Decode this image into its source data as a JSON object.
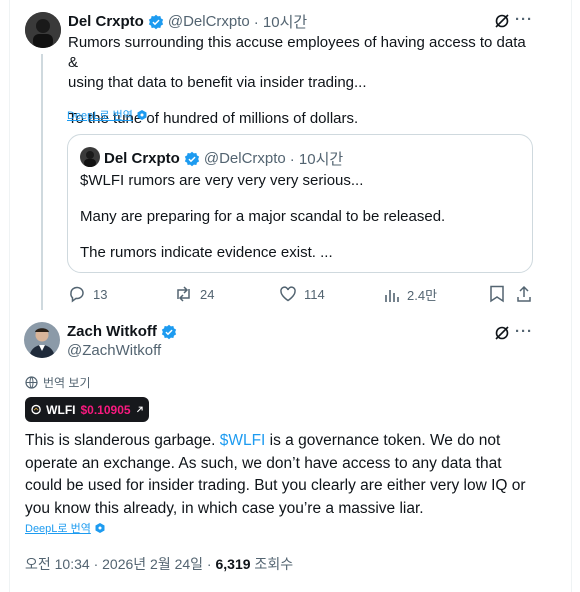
{
  "tweet1": {
    "name": "Del Crxpto",
    "handle": "@DelCrxpto",
    "time": "· 10시간",
    "line1": "Rumors surrounding this accuse employees of having access to data &",
    "line2": "using that data to benefit via insider trading...",
    "line3": "To the tune of hundred of millions of dollars.",
    "deepl": "DeepL로 번역",
    "more": "···"
  },
  "quote": {
    "name": "Del Crxpto",
    "handle": "@DelCrxpto",
    "time": "· 10시간",
    "line1": "$WLFI rumors are very very very serious...",
    "line2": "Many are preparing for a major scandal to be released.",
    "line3": "The rumors indicate evidence exist. ..."
  },
  "actions": {
    "replies": "13",
    "reposts": "24",
    "likes": "114",
    "views": "2.4만"
  },
  "tweet2": {
    "name": "Zach Witkoff",
    "handle": "@ZachWitkoff",
    "more": "···",
    "translate": "번역 보기",
    "token_symbol": "WLFI",
    "token_price": "$0.10905",
    "body_l1a": "This is slanderous garbage. ",
    "body_l1_link": "$WLFI",
    "body_l1b": " is a governance token. We do not",
    "body_l2": "operate an exchange. As such, we don’t have access to any data that",
    "body_l3": "could be used for insider trading. But you clearly are either very low IQ or",
    "body_l4": "you know this already, in which case you’re a massive liar.",
    "deepl": "DeepL로 번역",
    "timestamp": "오전 10:34 · 2026년 2월 24일 · ",
    "views_count": "6,319",
    "views_label": " 조회수"
  },
  "colors": {
    "accent": "#1d9bf0",
    "price": "#f9197f",
    "muted": "#536471"
  }
}
